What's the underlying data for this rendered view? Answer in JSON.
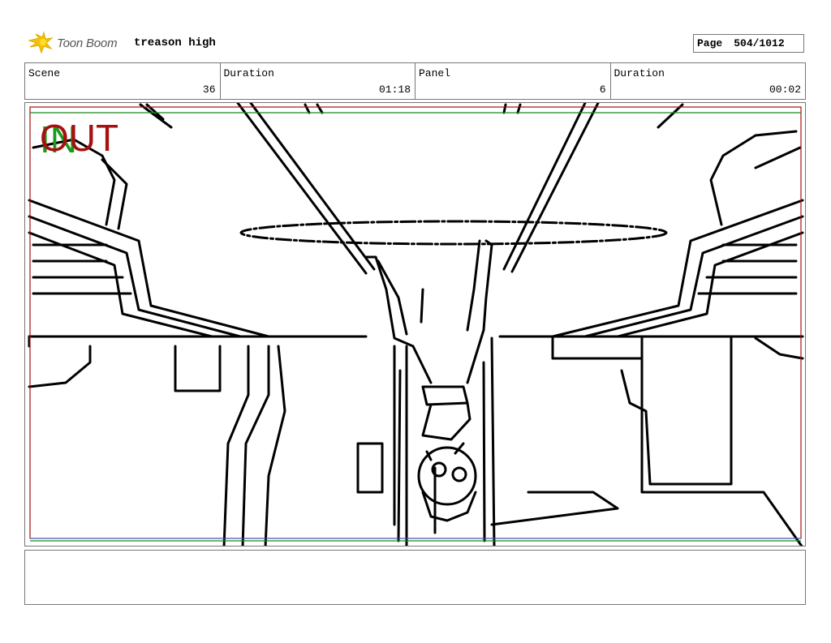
{
  "header": {
    "logo_text": "Toon Boom",
    "project_title": "treason high",
    "page_label": "Page",
    "page_value": "504/1012"
  },
  "info": {
    "scene_label": "Scene",
    "scene_value": "36",
    "scene_duration_label": "Duration",
    "scene_duration_value": "01:18",
    "panel_label": "Panel",
    "panel_value": "6",
    "panel_duration_label": "Duration",
    "panel_duration_value": "00:02"
  },
  "panel": {
    "in_marker": "IN",
    "out_marker": "OUT",
    "in_color": "#1a9a1a",
    "out_color": "#a81010"
  },
  "notes": {
    "text": ""
  }
}
